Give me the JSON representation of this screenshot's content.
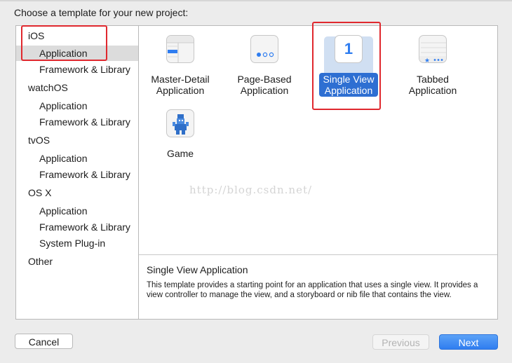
{
  "header": {
    "prompt": "Choose a template for your new project:"
  },
  "sidebar": {
    "items": [
      {
        "label": "iOS",
        "level": "category"
      },
      {
        "label": "Application",
        "level": "item",
        "selected": true
      },
      {
        "label": "Framework & Library",
        "level": "item"
      },
      {
        "label": "watchOS",
        "level": "category"
      },
      {
        "label": "Application",
        "level": "item"
      },
      {
        "label": "Framework & Library",
        "level": "item"
      },
      {
        "label": "tvOS",
        "level": "category"
      },
      {
        "label": "Application",
        "level": "item"
      },
      {
        "label": "Framework & Library",
        "level": "item"
      },
      {
        "label": "OS X",
        "level": "category"
      },
      {
        "label": "Application",
        "level": "item"
      },
      {
        "label": "Framework & Library",
        "level": "item"
      },
      {
        "label": "System Plug-in",
        "level": "item"
      },
      {
        "label": "Other",
        "level": "category"
      }
    ]
  },
  "templates": [
    {
      "label": "Master-Detail\nApplication",
      "icon": "master-detail-icon"
    },
    {
      "label": "Page-Based\nApplication",
      "icon": "page-based-icon"
    },
    {
      "label": "Single View\nApplication",
      "icon": "single-view-icon",
      "icon_text": "1",
      "selected": true
    },
    {
      "label": "Tabbed\nApplication",
      "icon": "tabbed-icon"
    },
    {
      "label": "Game",
      "icon": "game-icon"
    }
  ],
  "description": {
    "title": "Single View Application",
    "text": "This template provides a starting point for an application that uses a single view. It provides a view controller to manage the view, and a storyboard or nib file that contains the view."
  },
  "watermark": "http://blog.csdn.net/",
  "buttons": {
    "cancel": "Cancel",
    "previous": "Previous",
    "next": "Next"
  },
  "colors": {
    "selection": "#2e6fd2",
    "highlight_box": "#e0282e",
    "next_button": "#2f7df0"
  }
}
